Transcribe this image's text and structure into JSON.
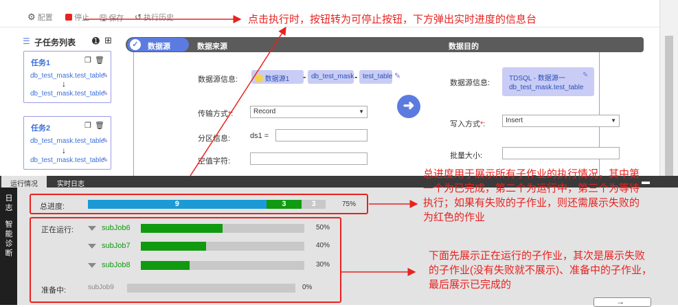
{
  "toolbar": {
    "config_label": "配置",
    "stop_label": "停止",
    "save_label": "保存",
    "history_label": "执行历史"
  },
  "sidebar": {
    "title": "子任务列表",
    "tasks": [
      {
        "name": "任务1",
        "source": "db_test_mask.test_table",
        "target": "db_test_mask.test_table"
      },
      {
        "name": "任务2",
        "source": "db_test_mask.test_table",
        "target": "db_test_mask.test_table"
      }
    ]
  },
  "header": {
    "pill": "数据源",
    "source_title": "数据来源",
    "target_title": "数据目的"
  },
  "source_form": {
    "ds_info_label": "数据源信息:",
    "chip_ds": "数据源1",
    "chip_db": "db_test_mask",
    "chip_table": "test_table",
    "sep1": "-",
    "sep2": "-",
    "transfer_label": "传输方式",
    "transfer_value": "Record",
    "partition_label": "分区信息:",
    "partition_key": "ds1 =",
    "null_label": "空值字符:"
  },
  "target_form": {
    "ds_info_label": "数据源信息:",
    "tdsql_line1": "TDSQL - 数据源一",
    "tdsql_line2": "db_test_mask.test_table",
    "write_label": "写入方式",
    "write_value": "Insert",
    "batch_label": "批量大小:"
  },
  "required_mark": "*",
  "required_colon": ":",
  "bottom": {
    "tab_status": "运行情况",
    "tab_log": "实时日志",
    "rail_log": [
      "日",
      "志"
    ],
    "rail_diag": [
      "智",
      "能",
      "诊",
      "断"
    ]
  },
  "progress": {
    "label": "总进度:",
    "done": 9,
    "running": 3,
    "waiting": 3,
    "percent_text": "75%",
    "percent": 75,
    "colors": {
      "done": "#1b9ad6",
      "running": "#109a10",
      "waiting": "#c8c8c8"
    }
  },
  "running": {
    "label": "正在运行:",
    "jobs": [
      {
        "name": "subJob6",
        "percent": 50,
        "percent_text": "50%"
      },
      {
        "name": "subJob7",
        "percent": 40,
        "percent_text": "40%"
      },
      {
        "name": "subJob8",
        "percent": 30,
        "percent_text": "30%"
      }
    ]
  },
  "pending": {
    "label": "准备中:",
    "job": "subJob9",
    "percent": 0,
    "percent_text": "0%"
  },
  "annotations": {
    "top": "点击执行时，按钮转为可停止按钮，下方弹出实时进度的信息台",
    "middle": [
      "总进度用于展示所有子作业的执行情况，其中第",
      "一个为已完成，第二个为运行中，第三个为等待",
      "执行；如果有失败的子作业，则还需展示失败的",
      "为红色的作业"
    ],
    "bottom": [
      "下面先展示正在运行的子作业，其次是展示失败",
      "的子作业(没有失败就不展示)、准备中的子作业，",
      "最后展示已完成的"
    ]
  },
  "colors": {
    "annotation": "#e8221f",
    "accent": "#5b7be0",
    "green": "#109a10",
    "blue": "#1b9ad6"
  }
}
